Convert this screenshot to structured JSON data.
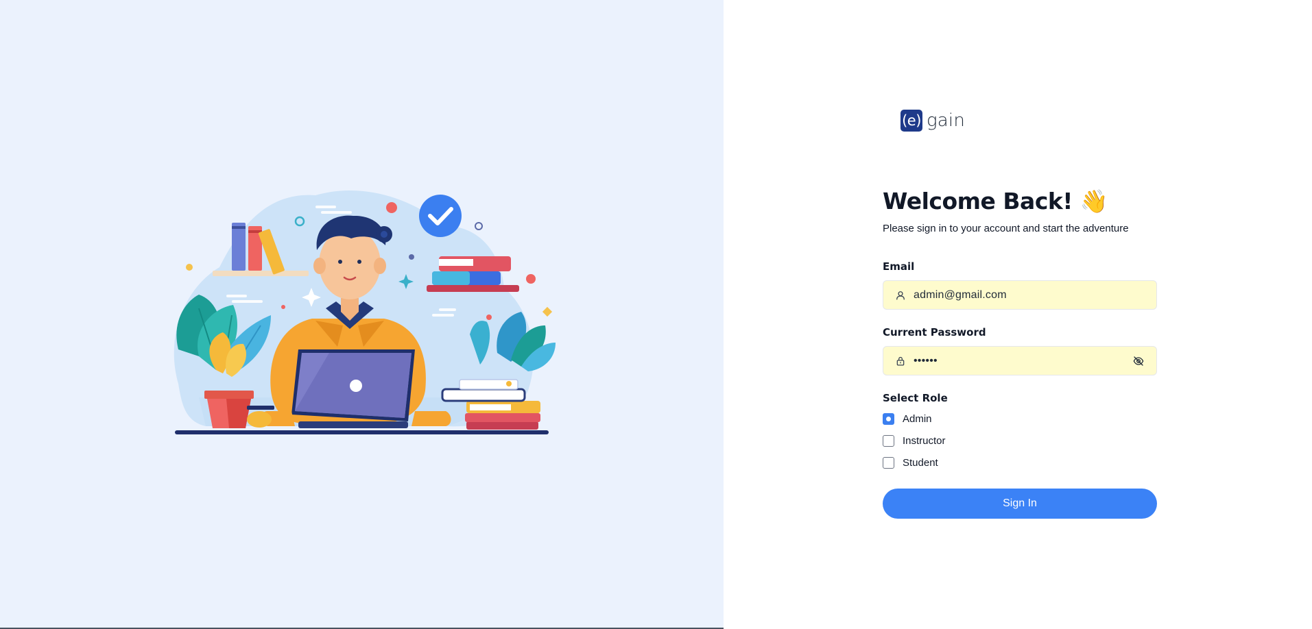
{
  "brand": {
    "mark": "(e)",
    "name": "gain"
  },
  "login": {
    "title": "Welcome Back!",
    "wave_icon": "👋",
    "subtitle": "Please sign in to your account and start the adventure",
    "email": {
      "label": "Email",
      "value": "admin@gmail.com",
      "icon": "user-icon"
    },
    "password": {
      "label": "Current Password",
      "value": "••••••",
      "icon": "lock-icon",
      "toggle_icon": "eye-off-icon"
    },
    "role": {
      "label": "Select Role",
      "options": [
        {
          "label": "Admin",
          "checked": true
        },
        {
          "label": "Instructor",
          "checked": false
        },
        {
          "label": "Student",
          "checked": false
        }
      ]
    },
    "submit_label": "Sign In"
  },
  "colors": {
    "accent": "#3b82f6",
    "left_bg": "#ebf2fd",
    "input_bg": "#fefbcd",
    "logo_bg": "#1e3a8a"
  }
}
